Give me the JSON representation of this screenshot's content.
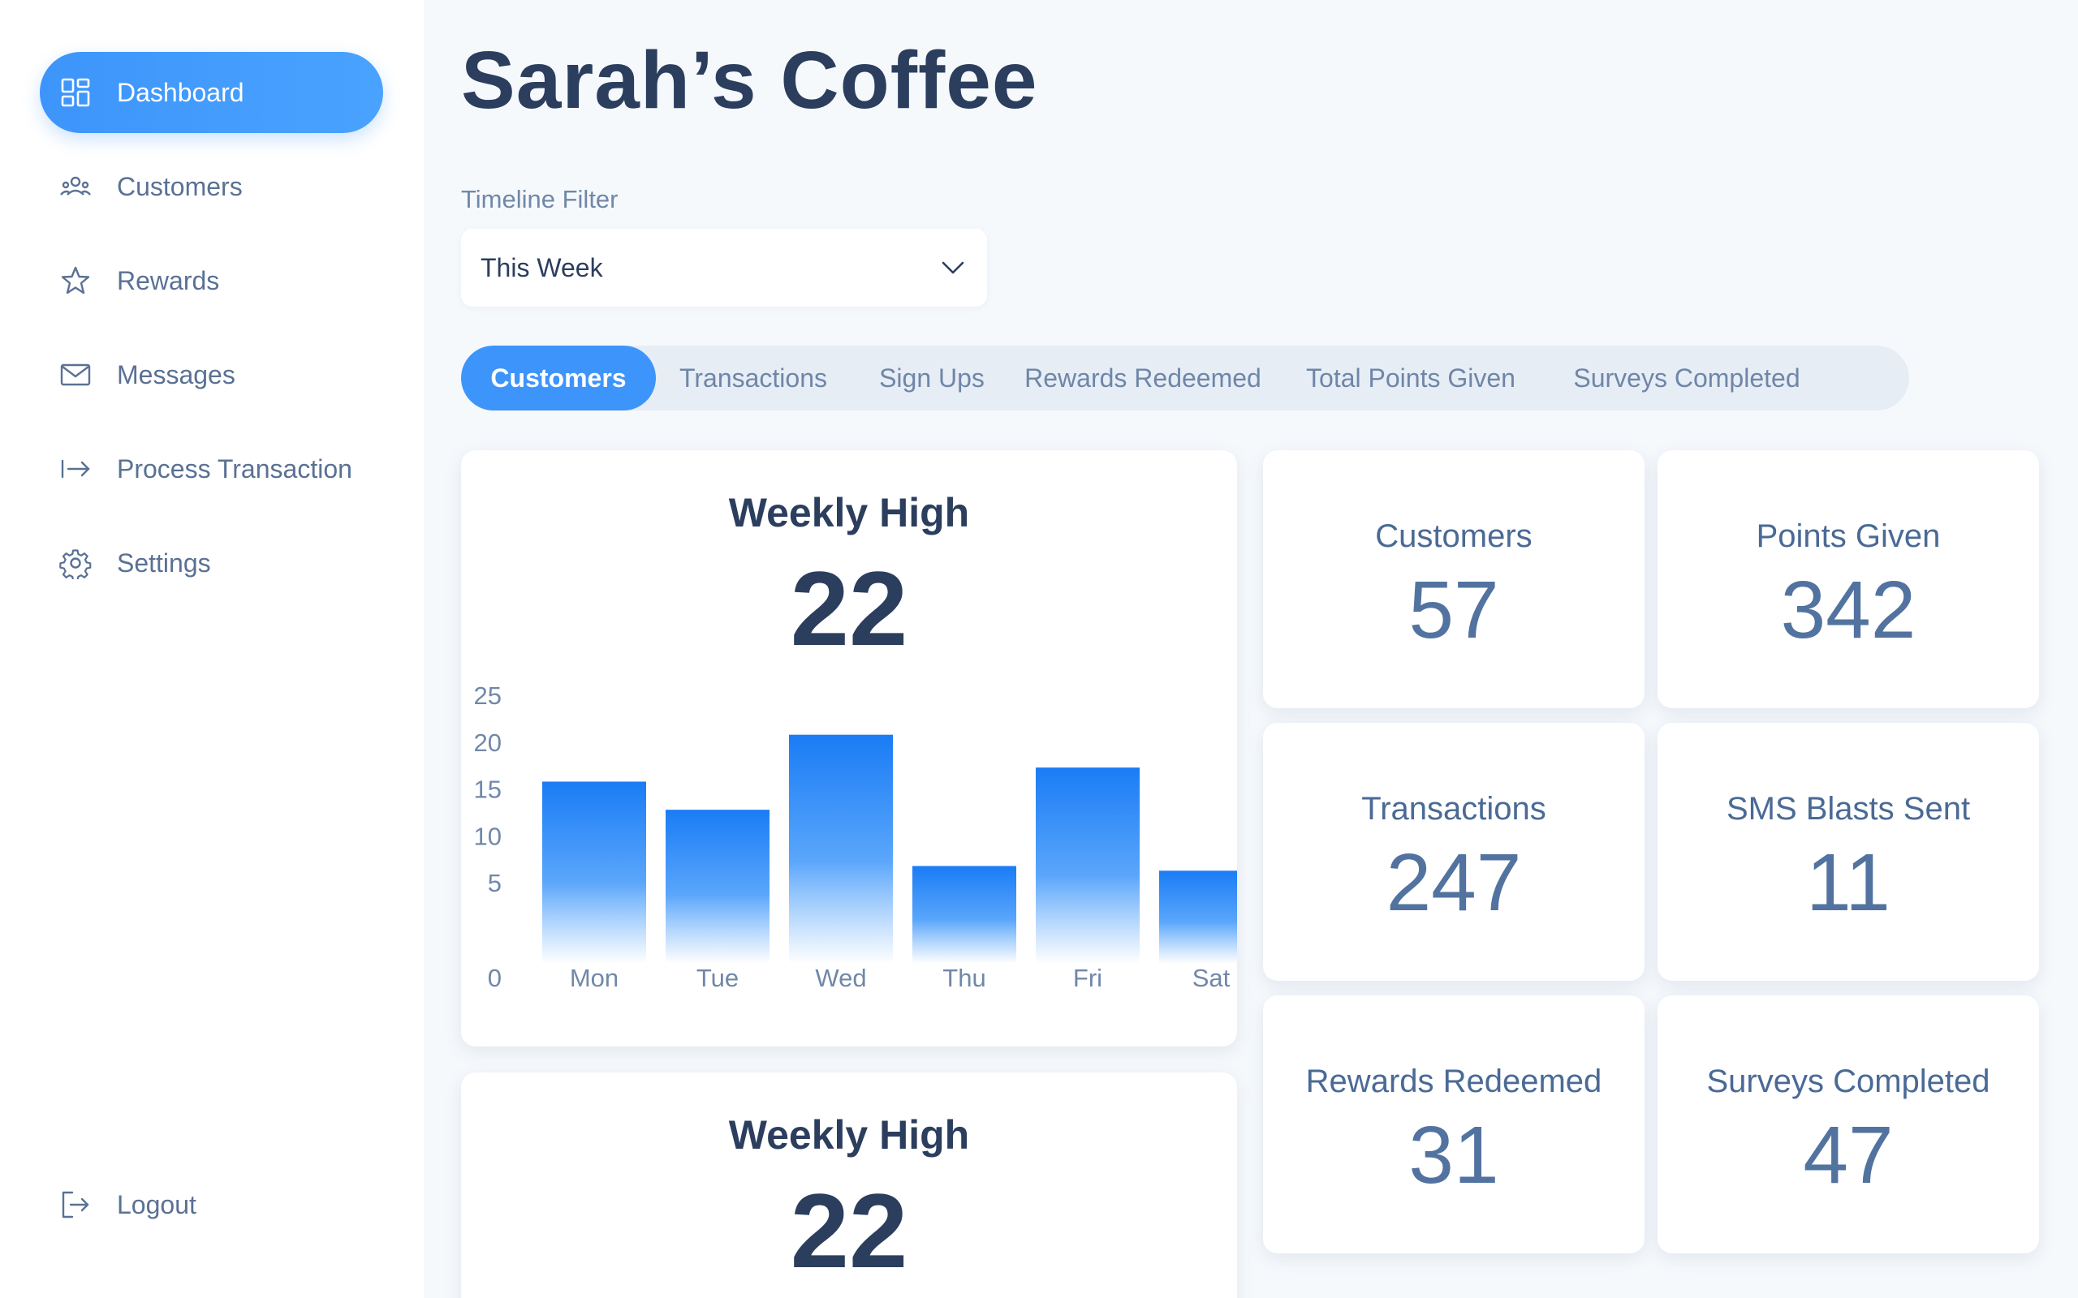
{
  "sidebar": {
    "items": [
      {
        "label": "Dashboard",
        "icon": "dashboard-grid-icon",
        "active": true
      },
      {
        "label": "Customers",
        "icon": "customers-group-icon",
        "active": false
      },
      {
        "label": "Rewards",
        "icon": "star-icon",
        "active": false
      },
      {
        "label": "Messages",
        "icon": "envelope-icon",
        "active": false
      },
      {
        "label": "Process Transaction",
        "icon": "arrow-right-bar-icon",
        "active": false
      },
      {
        "label": "Settings",
        "icon": "gear-icon",
        "active": false
      }
    ],
    "logout": {
      "label": "Logout",
      "icon": "logout-icon"
    }
  },
  "header": {
    "title": "Sarah’s Coffee"
  },
  "filter": {
    "label": "Timeline Filter",
    "value": "This Week"
  },
  "tabs": [
    {
      "label": "Customers",
      "active": true
    },
    {
      "label": "Transactions",
      "active": false
    },
    {
      "label": "Sign Ups",
      "active": false
    },
    {
      "label": "Rewards Redeemed",
      "active": false
    },
    {
      "label": "Total Points Given",
      "active": false
    },
    {
      "label": "Surveys Completed",
      "active": false
    }
  ],
  "weekly_card": {
    "title": "Weekly High",
    "value": "22"
  },
  "weekly_card_2": {
    "title": "Weekly High",
    "value": "22"
  },
  "stats": [
    {
      "label": "Customers",
      "value": "57"
    },
    {
      "label": "Points Given",
      "value": "342"
    },
    {
      "label": "Transactions",
      "value": "247"
    },
    {
      "label": "SMS Blasts Sent",
      "value": "11"
    },
    {
      "label": "Rewards Redeemed",
      "value": "31"
    },
    {
      "label": "Surveys Completed",
      "value": "47"
    }
  ],
  "colors": {
    "accent": "#3d95fb",
    "title": "#2c3e5e",
    "muted": "#7088a8"
  },
  "chart_data": {
    "type": "bar",
    "categories": [
      "Mon",
      "Tue",
      "Wed",
      "Thu",
      "Fri",
      "Sat"
    ],
    "values": [
      17,
      14,
      22,
      8,
      18.5,
      7.5
    ],
    "yticks": [
      "25",
      "20",
      "15",
      "10",
      "5",
      "0"
    ],
    "ylim": [
      0,
      25
    ],
    "grid": false
  }
}
